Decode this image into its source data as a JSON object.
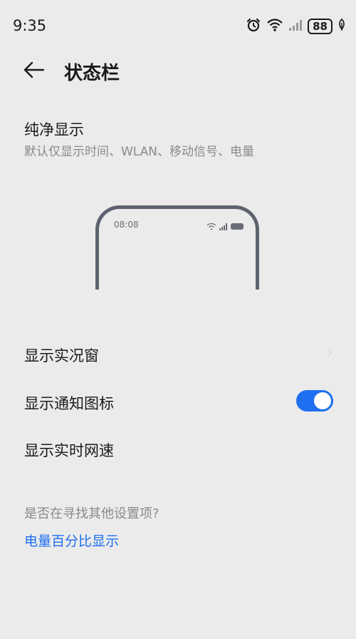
{
  "status_bar": {
    "time": "9:35",
    "battery": "88",
    "icons": [
      "alarm-icon",
      "wifi-icon",
      "cellular-signal-icon",
      "battery-icon",
      "leaf-icon"
    ]
  },
  "header": {
    "title": "状态栏",
    "back_icon": "back-arrow-icon"
  },
  "clean_display": {
    "title": "纯净显示",
    "description": "默认仅显示时间、WLAN、移动信号、电量"
  },
  "preview": {
    "time": "08:08"
  },
  "settings": [
    {
      "label": "显示实况窗",
      "control": "chevron"
    },
    {
      "label": "显示通知图标",
      "control": "toggle",
      "enabled": true
    },
    {
      "label": "显示实时网速",
      "control": "none"
    }
  ],
  "search": {
    "hint": "是否在寻找其他设置项?",
    "suggestion": "电量百分比显示"
  },
  "colors": {
    "background": "#ebebeb",
    "accent": "#1f6ff0",
    "secondary_text": "#8a8a8a",
    "frame": "#5e6270"
  }
}
